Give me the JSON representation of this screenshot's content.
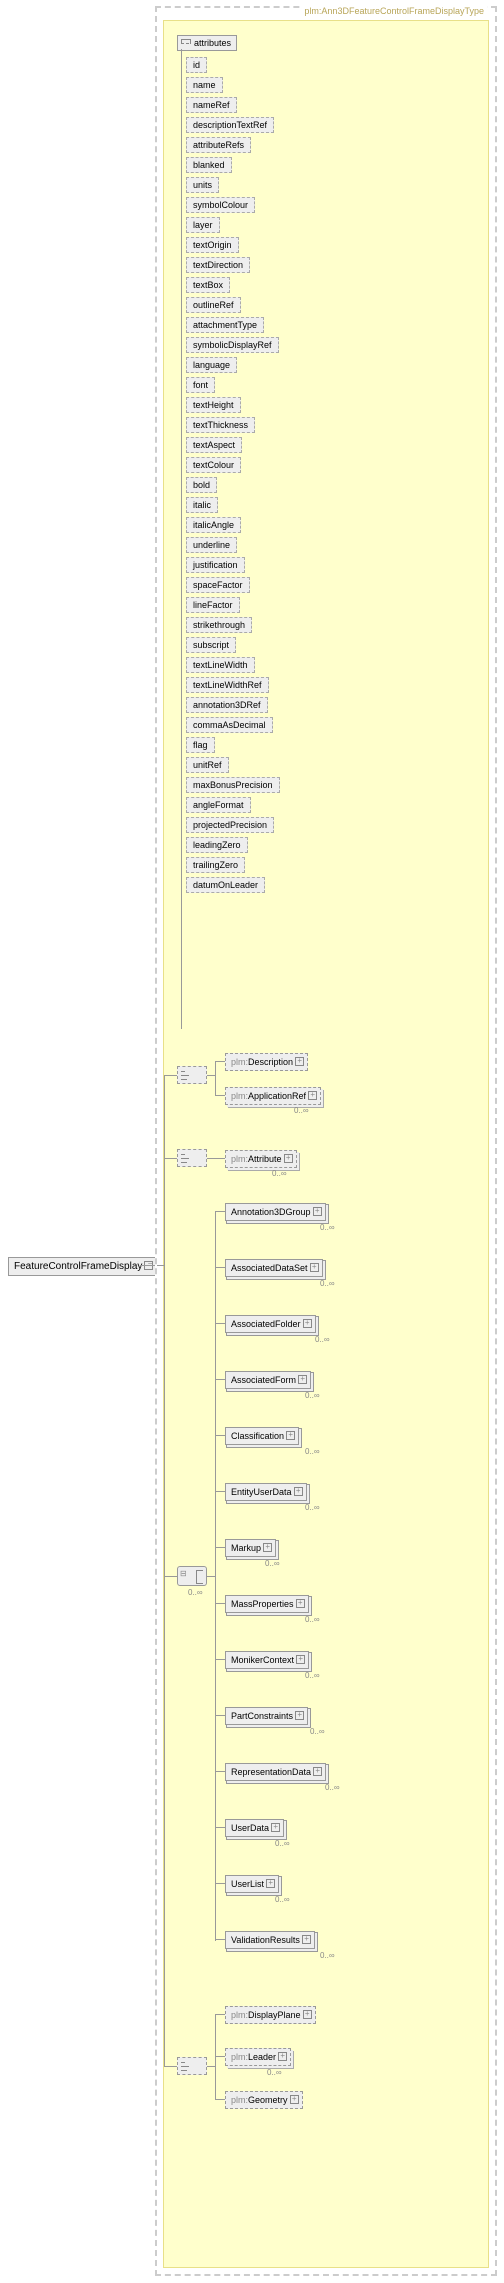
{
  "root": "FeatureControlFrameDisplay",
  "typeName": "plm:Ann3DFeatureControlFrameDisplayType",
  "attrHead": "attributes",
  "attrs": [
    "id",
    "name",
    "nameRef",
    "descriptionTextRef",
    "attributeRefs",
    "blanked",
    "units",
    "symbolColour",
    "layer",
    "textOrigin",
    "textDirection",
    "textBox",
    "outlineRef",
    "attachmentType",
    "symbolicDisplayRef",
    "language",
    "font",
    "textHeight",
    "textThickness",
    "textAspect",
    "textColour",
    "bold",
    "italic",
    "italicAngle",
    "underline",
    "justification",
    "spaceFactor",
    "lineFactor",
    "strikethrough",
    "subscript",
    "textLineWidth",
    "textLineWidthRef",
    "annotation3DRef",
    "commaAsDecimal",
    "flag",
    "unitRef",
    "maxBonusPrecision",
    "angleFormat",
    "projectedPrecision",
    "leadingZero",
    "trailingZero",
    "datumOnLeader"
  ],
  "ns": "plm:",
  "elems": {
    "desc": "Description",
    "appref": "ApplicationRef",
    "attr": "Attribute",
    "displayPlane": "DisplayPlane",
    "leader": "Leader",
    "geometry": "Geometry"
  },
  "choiceElems": [
    "Annotation3DGroup",
    "AssociatedDataSet",
    "AssociatedFolder",
    "AssociatedForm",
    "Classification",
    "EntityUserData",
    "Markup",
    "MassProperties",
    "MonikerContext",
    "PartConstraints",
    "RepresentationData",
    "UserData",
    "UserList",
    "ValidationResults"
  ],
  "card": "0..∞"
}
